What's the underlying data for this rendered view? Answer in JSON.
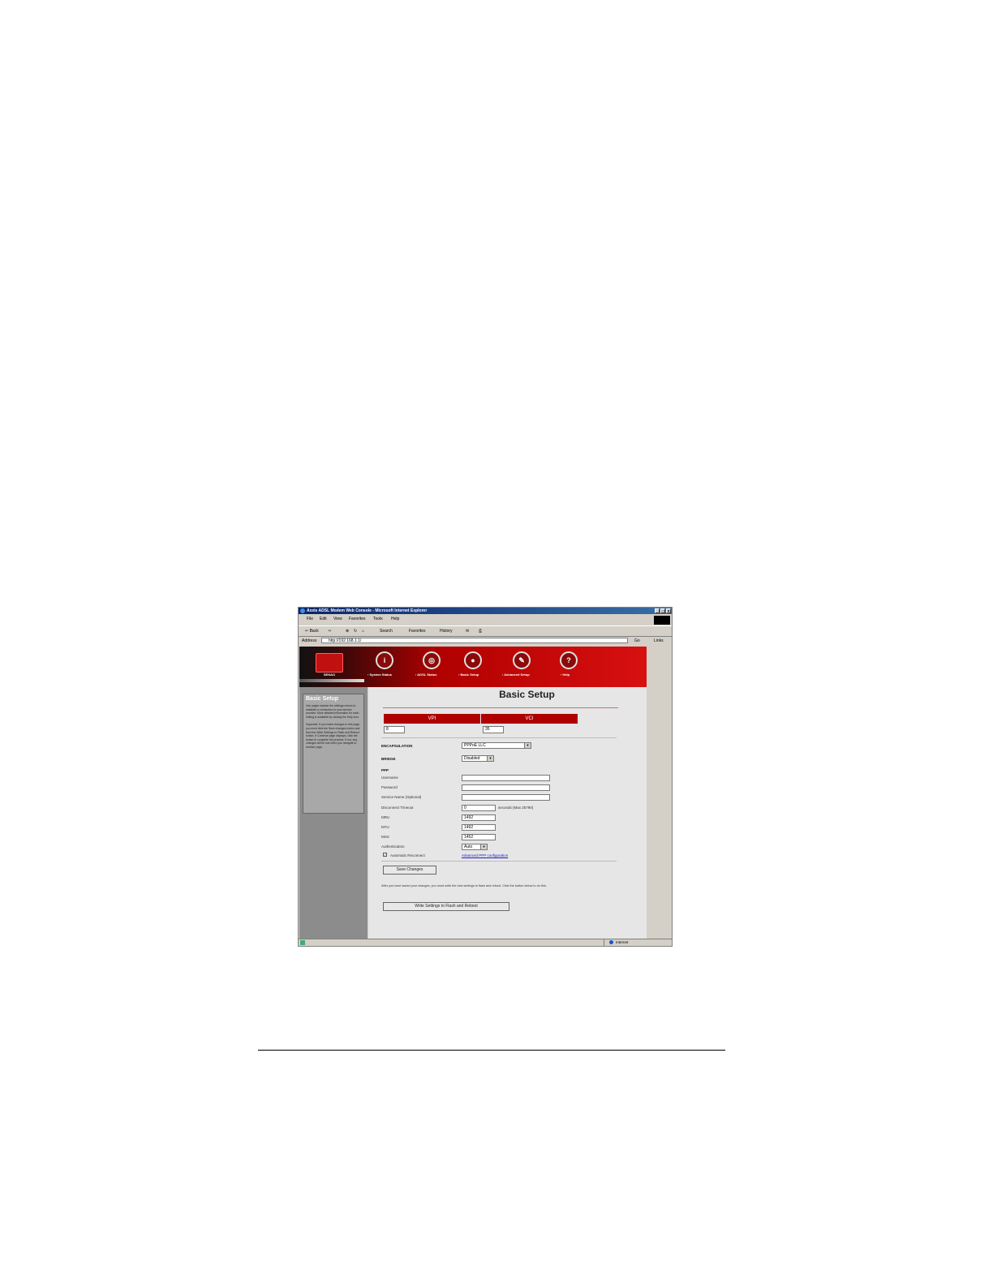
{
  "window": {
    "title": "Axxis ADSL Modem Web Console - Microsoft Internet Explorer",
    "min": "_",
    "max": "□",
    "close": "×"
  },
  "menu": [
    "File",
    "Edit",
    "View",
    "Favorites",
    "Tools",
    "Help"
  ],
  "toolbar": {
    "back": "⇐ Back",
    "forward": "⇒",
    "search": "Search",
    "favorites": "Favorites",
    "history": "History"
  },
  "address": {
    "label": "Address",
    "value": "http://192.168.1.1/",
    "go": "Go",
    "links": "Links"
  },
  "header": {
    "logo_text": "SENAO",
    "nav": [
      {
        "label": "› System Status",
        "icon_glyph": "i"
      },
      {
        "label": "› ADSL Status",
        "icon_glyph": "◎"
      },
      {
        "label": "› Basic Setup",
        "icon_glyph": "●"
      },
      {
        "label": "› Advanced Setup",
        "icon_glyph": "✎"
      },
      {
        "label": "› Help",
        "icon_glyph": "?"
      }
    ]
  },
  "sidebar": {
    "title": "Basic Setup",
    "text1": "Use pages replace the settings menus to establish a connection to your service provider. More detailed information for each setting is available by clicking the Help icon.",
    "text2": "Important: If you make changes to this page, you must click the Save changes button and then the Write Settings to Flash and Reboot button. If Continue page displays, click the button to complete the process. If not, any changes will be lost when you navigate to another page."
  },
  "main": {
    "title": "Basic Setup",
    "vpi_header": "VPI",
    "vci_header": "VCI",
    "vpi_value": "8",
    "vci_value": "35",
    "encapsulation_label": "ENCAPSULATION",
    "encapsulation_value": "PPPoE LLC",
    "bridge_label": "BRIDGE",
    "bridge_value": "Disabled",
    "ppp_label": "PPP",
    "username_label": "Username",
    "password_label": "Password",
    "service_label": "Service Name (Optional)",
    "disconnect_label": "Disconnect Timeout",
    "disconnect_value": "0",
    "disconnect_unit": "seconds (Max 25790)",
    "mru_label": "MRU",
    "mru_value": "1492",
    "mtu_label": "MTU",
    "mtu_value": "1492",
    "mss_label": "MSS",
    "mss_value": "1452",
    "auth_label": "Authentication",
    "auth_value": "Auto",
    "auto_reconnect_label": "Automatic Reconnect",
    "advanced_link": "Advanced PPP configuration",
    "save_button": "Save Changes",
    "note": "After you have saved your changes, you must write the new settings to flash and reboot. Click the button below to do this.",
    "write_button": "Write Settings to Flash and Reboot"
  },
  "status": {
    "zone": "Internet"
  }
}
